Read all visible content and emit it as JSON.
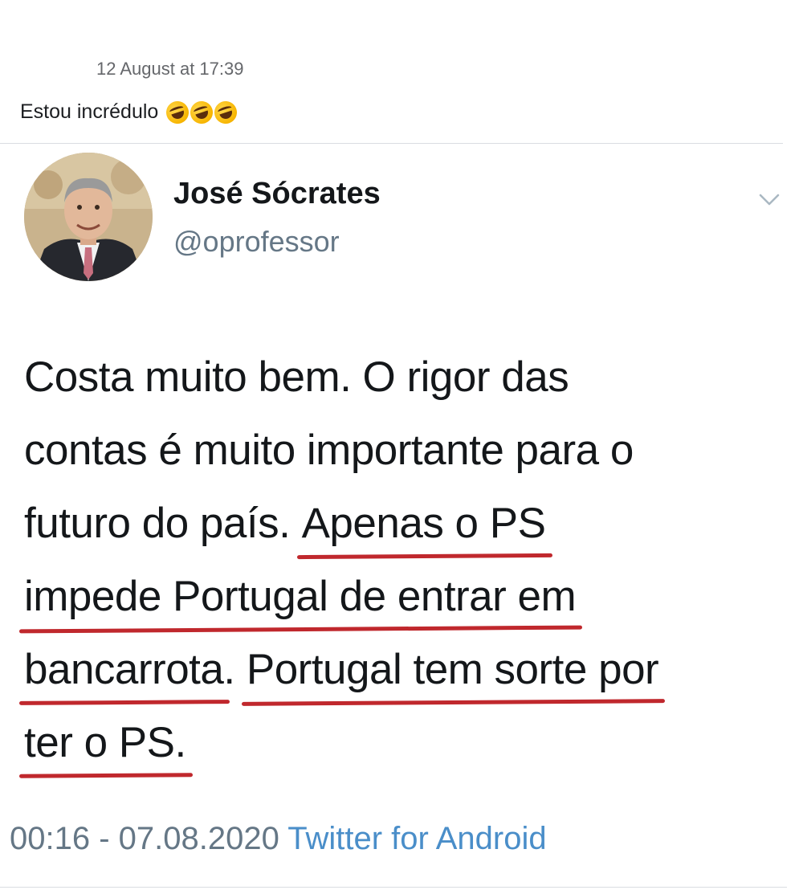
{
  "post": {
    "timestamp": "12 August at 17:39",
    "caption": "Estou incrédulo",
    "caption_emoji": "rolling-on-the-floor-laughing-icon",
    "caption_emoji_count": 3
  },
  "tweet": {
    "author_name": "José Sócrates",
    "author_handle": "@oprofessor",
    "menu_icon": "chevron-down-icon",
    "lines": [
      [
        "Costa muito bem. O rigor das"
      ],
      [
        "contas é muito importante para o"
      ],
      [
        "futuro do país. ",
        "Apenas o PS"
      ],
      [
        "impede Portugal de entrar em"
      ],
      [
        "bancarrota",
        ". ",
        "Portugal tem sorte por"
      ],
      [
        "ter o PS."
      ]
    ],
    "time": "00:16 - 07.08.2020",
    "source": "Twitter for Android"
  },
  "colors": {
    "underline": "#c0282d",
    "source_link": "#4a8ec9",
    "muted": "#657786"
  }
}
